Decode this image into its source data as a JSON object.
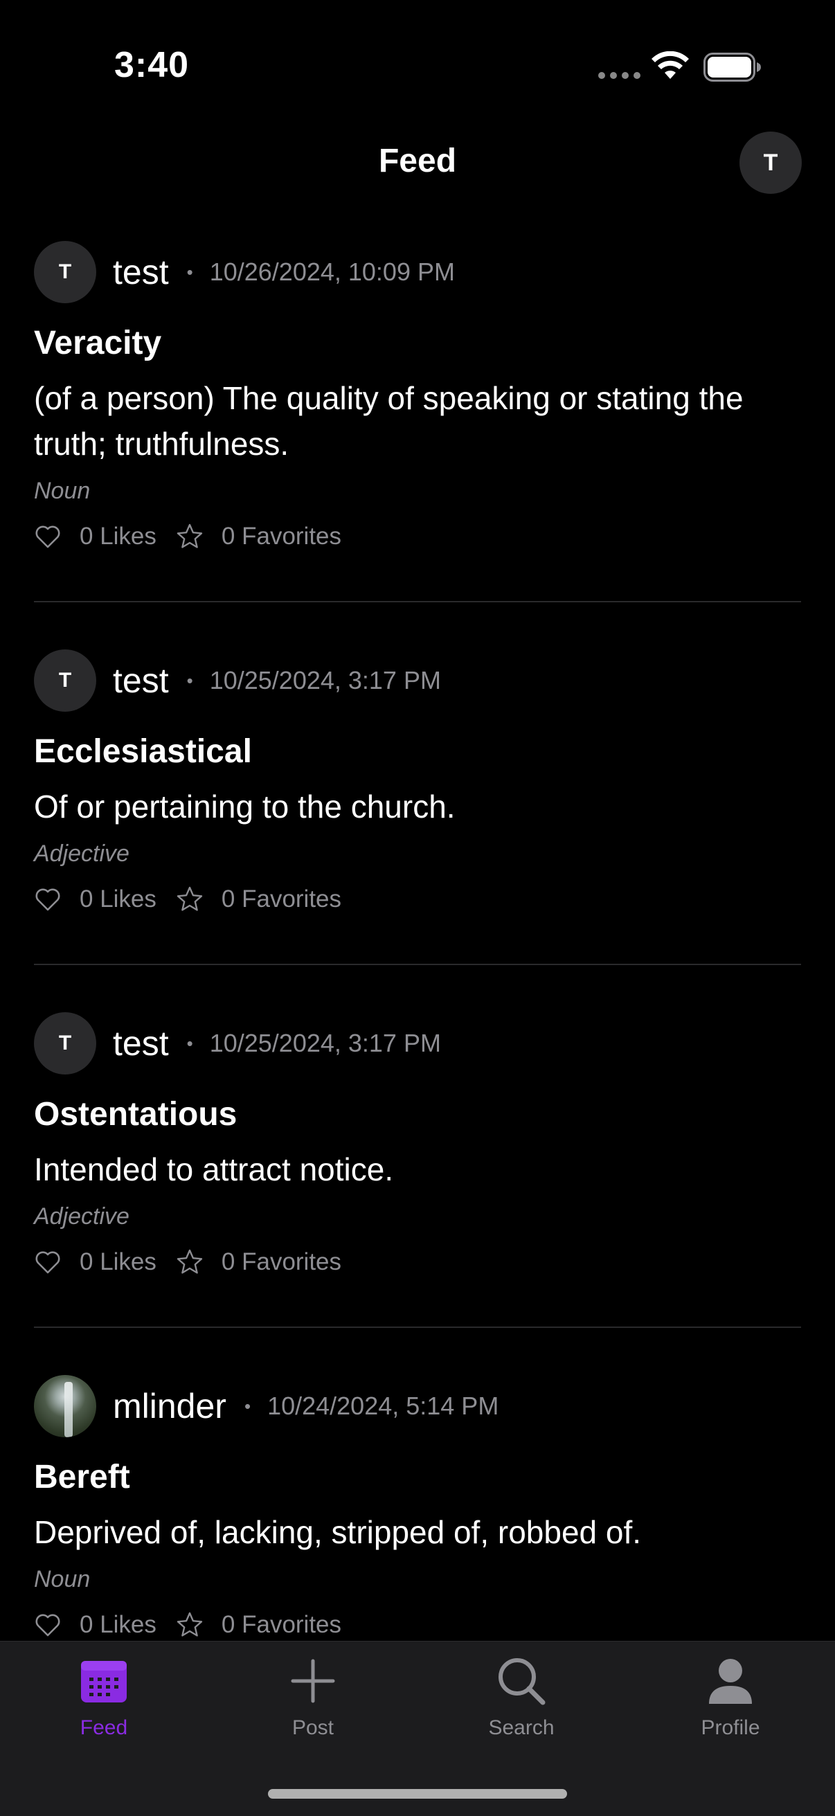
{
  "status_bar": {
    "time": "3:40"
  },
  "nav": {
    "title": "Feed",
    "avatar_initial": "T"
  },
  "posts": [
    {
      "avatar_initial": "T",
      "avatar_type": "initial",
      "username": "test",
      "dot": "•",
      "date": "10/26/2024, 10:09 PM",
      "word": "Veracity",
      "definition": "(of a person) The quality of speaking or stating the truth; truthfulness.",
      "part_of_speech": "Noun",
      "likes": "0 Likes",
      "favorites": "0 Favorites"
    },
    {
      "avatar_initial": "T",
      "avatar_type": "initial",
      "username": "test",
      "dot": "•",
      "date": "10/25/2024, 3:17 PM",
      "word": "Ecclesiastical",
      "definition": "Of or pertaining to the church.",
      "part_of_speech": "Adjective",
      "likes": "0 Likes",
      "favorites": "0 Favorites"
    },
    {
      "avatar_initial": "T",
      "avatar_type": "initial",
      "username": "test",
      "dot": "•",
      "date": "10/25/2024, 3:17 PM",
      "word": "Ostentatious",
      "definition": "Intended to attract notice.",
      "part_of_speech": "Adjective",
      "likes": "0 Likes",
      "favorites": "0 Favorites"
    },
    {
      "avatar_initial": "",
      "avatar_type": "photo",
      "username": "mlinder",
      "dot": "•",
      "date": "10/24/2024, 5:14 PM",
      "word": "Bereft",
      "definition": "Deprived of, lacking, stripped of, robbed of.",
      "part_of_speech": "Noun",
      "likes": "0 Likes",
      "favorites": "0 Favorites"
    }
  ],
  "tab_bar": {
    "tabs": [
      {
        "label": "Feed",
        "icon": "calendar-icon",
        "active": true
      },
      {
        "label": "Post",
        "icon": "plus-icon",
        "active": false
      },
      {
        "label": "Search",
        "icon": "search-icon",
        "active": false
      },
      {
        "label": "Profile",
        "icon": "person-icon",
        "active": false
      }
    ]
  },
  "colors": {
    "background": "#000000",
    "accent": "#8a2be2",
    "secondary_text": "#8e8e93",
    "tab_bar_bg": "#1c1c1e"
  }
}
